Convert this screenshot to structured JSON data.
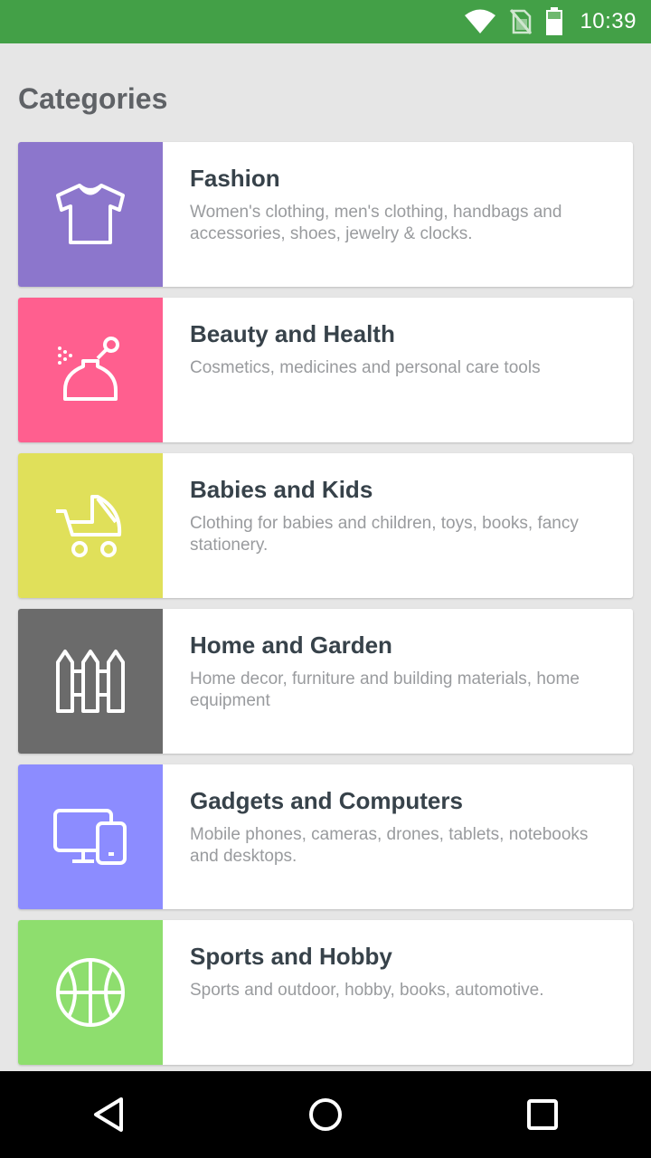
{
  "status_bar": {
    "time": "10:39",
    "icons": [
      "wifi-icon",
      "no-sim-icon",
      "battery-icon"
    ],
    "color": "#43a047"
  },
  "page": {
    "title": "Categories"
  },
  "categories": [
    {
      "title": "Fashion",
      "description": "Women's clothing, men's clothing, handbags and accessories, shoes, jewelry & clocks.",
      "icon": "tshirt-icon",
      "color": "#8c76cc"
    },
    {
      "title": "Beauty and Health",
      "description": "Cosmetics, medicines and personal care tools",
      "icon": "perfume-icon",
      "color": "#ff5f8f"
    },
    {
      "title": "Babies and Kids",
      "description": "Clothing for babies and children, toys, books, fancy stationery.",
      "icon": "stroller-icon",
      "color": "#e0e05a"
    },
    {
      "title": "Home and Garden",
      "description": "Home decor, furniture and building materials, home equipment",
      "icon": "fence-icon",
      "color": "#6b6b6b"
    },
    {
      "title": "Gadgets and Computers",
      "description": "Mobile phones, cameras, drones, tablets, notebooks and desktops.",
      "icon": "devices-icon",
      "color": "#8c8cff"
    },
    {
      "title": "Sports and Hobby",
      "description": "Sports and outdoor, hobby, books, automotive.",
      "icon": "basketball-icon",
      "color": "#8ede6e"
    }
  ],
  "nav_bar": {
    "buttons": [
      "back-icon",
      "home-icon",
      "recents-icon"
    ]
  }
}
